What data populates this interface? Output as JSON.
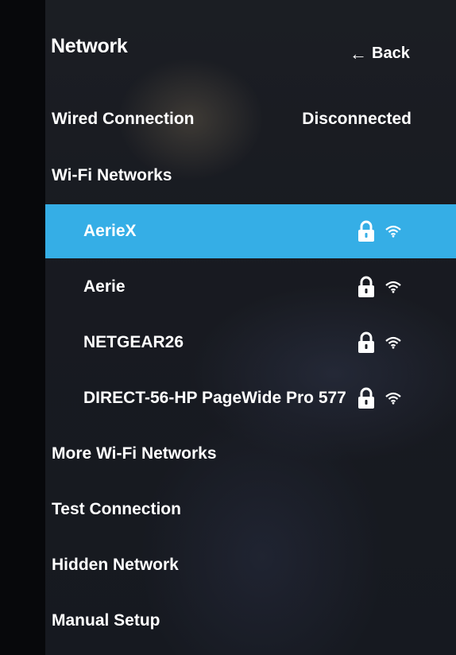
{
  "header": {
    "title": "Network",
    "back_label": "Back"
  },
  "wired": {
    "label": "Wired Connection",
    "status": "Disconnected"
  },
  "wifi_section": {
    "label": "Wi-Fi Networks"
  },
  "networks": [
    {
      "name": "AerieX",
      "secured": true,
      "icons": [
        "lock-icon",
        "wifi-signal-icon"
      ],
      "selected": true
    },
    {
      "name": "Aerie",
      "secured": true,
      "icons": [
        "lock-icon",
        "wifi-signal-icon"
      ],
      "selected": false
    },
    {
      "name": "NETGEAR26",
      "secured": true,
      "icons": [
        "lock-icon",
        "wifi-signal-icon"
      ],
      "selected": false
    },
    {
      "name": "DIRECT-56-HP PageWide Pro 577",
      "secured": true,
      "icons": [
        "lock-icon",
        "wifi-signal-icon"
      ],
      "selected": false
    }
  ],
  "menu": {
    "more_wifi": "More Wi-Fi Networks",
    "test_connection": "Test Connection",
    "hidden_network": "Hidden Network",
    "manual_setup": "Manual Setup"
  },
  "colors": {
    "selection": "#35aee6",
    "text": "#ffffff"
  }
}
